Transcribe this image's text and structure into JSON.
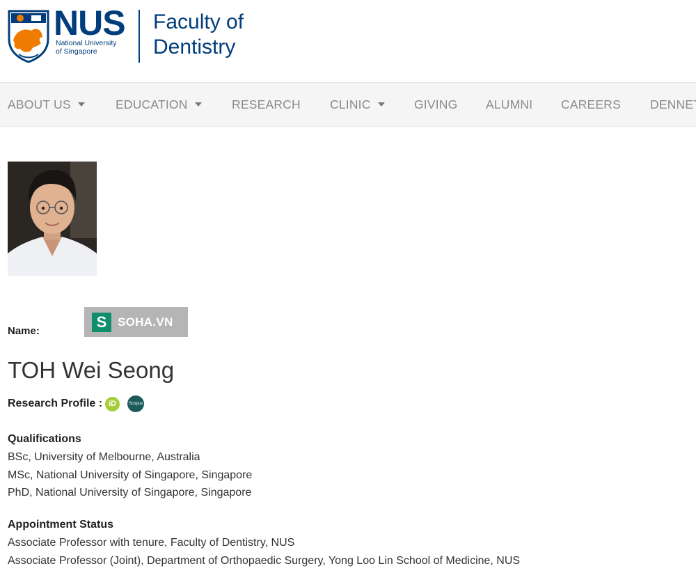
{
  "logo": {
    "nus": "NUS",
    "sub_line1": "National University",
    "sub_line2": "of Singapore",
    "faculty_line1": "Faculty of",
    "faculty_line2": "Dentistry"
  },
  "nav": {
    "items": [
      {
        "label": "ABOUT US",
        "dropdown": true
      },
      {
        "label": "EDUCATION",
        "dropdown": true
      },
      {
        "label": "RESEARCH",
        "dropdown": false
      },
      {
        "label": "CLINIC",
        "dropdown": true
      },
      {
        "label": "GIVING",
        "dropdown": false
      },
      {
        "label": "ALUMNI",
        "dropdown": false
      },
      {
        "label": "CAREERS",
        "dropdown": false
      },
      {
        "label": "DENNET",
        "dropdown": false
      }
    ]
  },
  "watermark": {
    "letter": "S",
    "text": "SOHA.VN"
  },
  "profile": {
    "name_label": "Name:",
    "name": "TOH Wei Seong",
    "research_profile_label": "Research Profile :",
    "orcid_icon_text": "iD",
    "scopus_icon_text": "Scopus"
  },
  "qualifications": {
    "title": "Qualifications",
    "items": [
      "BSc, University of Melbourne, Australia",
      "MSc, National University of Singapore, Singapore",
      "PhD, National University of Singapore, Singapore"
    ]
  },
  "appointment": {
    "title": "Appointment Status",
    "items": [
      "Associate Professor with tenure, Faculty of Dentistry, NUS",
      "Associate Professor (Joint), Department of Orthopaedic Surgery, Yong Loo Lin School of Medicine, NUS"
    ]
  },
  "colors": {
    "brand_blue": "#003d7c",
    "nav_bg": "#f5f5f5",
    "nav_text": "#8a8a8a",
    "orcid_green": "#a6ce39",
    "scopus_teal": "#1d5b5b"
  }
}
